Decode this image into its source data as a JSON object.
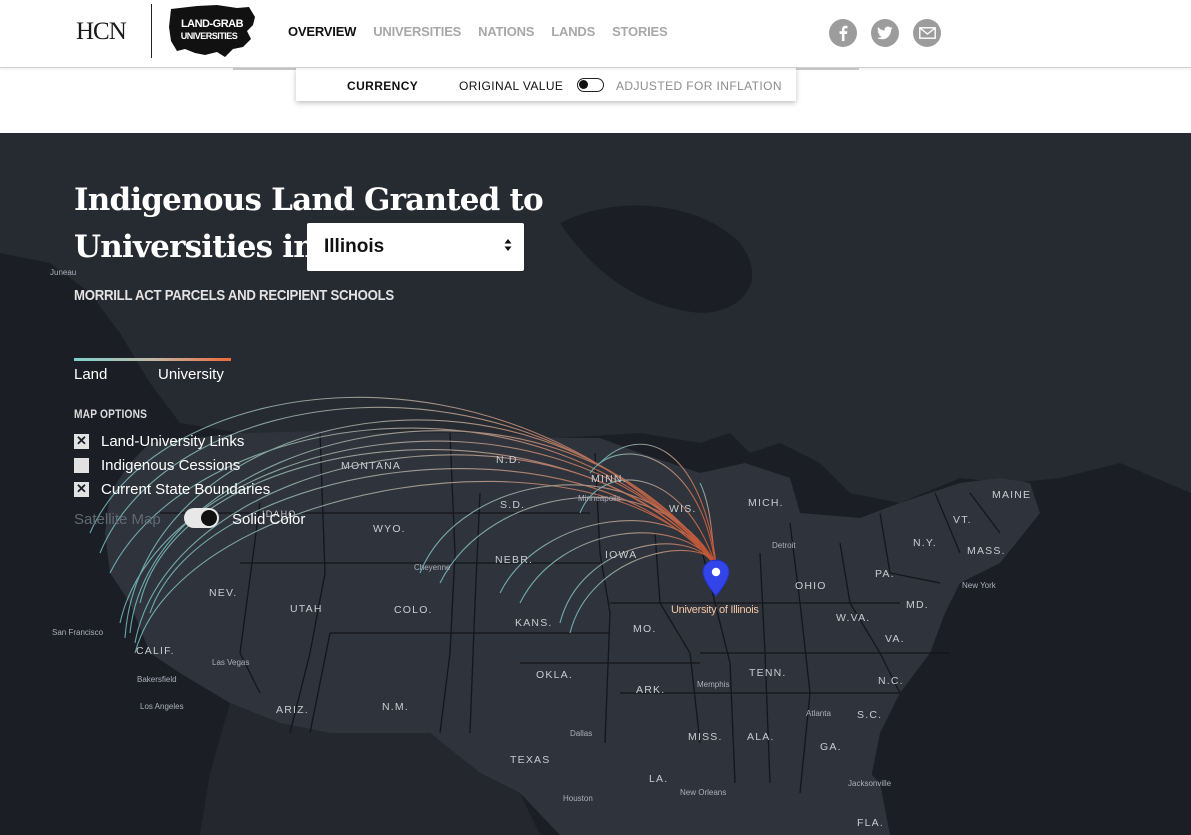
{
  "header": {
    "hcn_logo": "HCN",
    "lgu_logo_text": "LAND-GRAB UNIVERSITIES",
    "nav": [
      {
        "label": "OVERVIEW",
        "active": true
      },
      {
        "label": "UNIVERSITIES",
        "active": false
      },
      {
        "label": "NATIONS",
        "active": false
      },
      {
        "label": "LANDS",
        "active": false
      },
      {
        "label": "STORIES",
        "active": false
      }
    ],
    "social": [
      "facebook-icon",
      "twitter-icon",
      "email-icon"
    ]
  },
  "currency": {
    "label": "CURRENCY",
    "original": "ORIGINAL VALUE",
    "adjusted": "ADJUSTED FOR INFLATION",
    "mode": "original"
  },
  "map": {
    "title": "Indigenous Land Granted to Universities in",
    "selected_state": "Illinois",
    "subtitle": "MORRILL ACT PARCELS AND RECIPIENT SCHOOLS",
    "legend": {
      "start": "Land",
      "end": "University",
      "colors": [
        "#7fd0d0",
        "#ee6a3a"
      ]
    },
    "options_title": "MAP OPTIONS",
    "options": [
      {
        "label": "Land-University Links",
        "checked": true
      },
      {
        "label": "Indigenous Cessions",
        "checked": false
      },
      {
        "label": "Current State Boundaries",
        "checked": true
      }
    ],
    "toggle": {
      "left": "Satellite Map",
      "right": "Solid Color",
      "selected": "Solid Color"
    },
    "university": "University of Illinois",
    "state_labels": [
      "MONTANA",
      "N.D.",
      "S.D.",
      "WYO.",
      "NEV.",
      "UTAH",
      "COLO.",
      "NEBR.",
      "KANS.",
      "IOWA",
      "MINN.",
      "WIS.",
      "MICH.",
      "OHIO",
      "PA.",
      "N.Y.",
      "VT.",
      "MAINE",
      "MASS.",
      "MD.",
      "W.VA.",
      "VA.",
      "N.C.",
      "S.C.",
      "GA.",
      "ALA.",
      "MISS.",
      "TENN.",
      "ARK.",
      "MO.",
      "OKLA.",
      "TEXAS",
      "LA.",
      "FLA.",
      "N.M.",
      "ARIZ.",
      "CALIF.",
      "IDAHO"
    ],
    "city_labels": [
      "Juneau",
      "San Francisco",
      "Las Vegas",
      "Bakersfield",
      "Los Angeles",
      "Cheyenne",
      "Minneapolis",
      "Detroit",
      "New York",
      "Memphis",
      "Atlanta",
      "Dallas",
      "Houston",
      "New Orleans",
      "Jacksonville"
    ]
  }
}
